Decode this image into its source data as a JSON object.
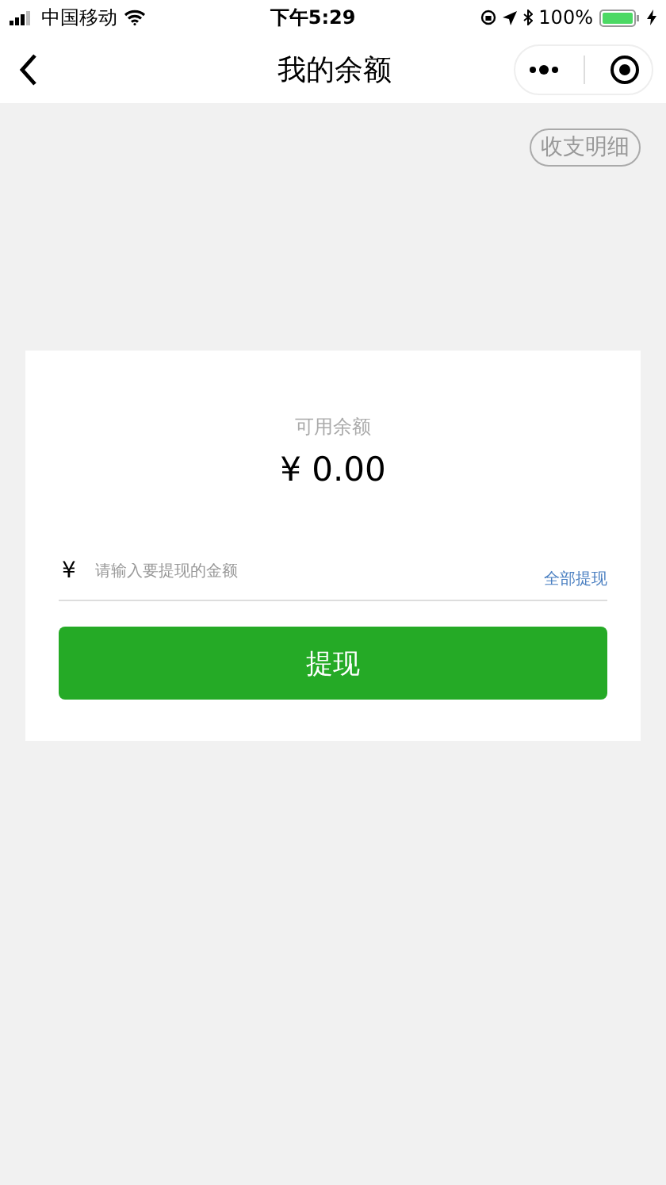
{
  "status_bar": {
    "carrier": "中国移动",
    "time": "下午5:29",
    "battery": "100%"
  },
  "nav_bar": {
    "title": "我的余额"
  },
  "details_button": {
    "label": "收支明细"
  },
  "balance_card": {
    "label": "可用余额",
    "amount": "¥ 0.00",
    "currency": "¥",
    "amount_field": {
      "placeholder": "请输入要提现的金额"
    },
    "withdraw_all": "全部提现",
    "withdraw_button": "提现"
  }
}
